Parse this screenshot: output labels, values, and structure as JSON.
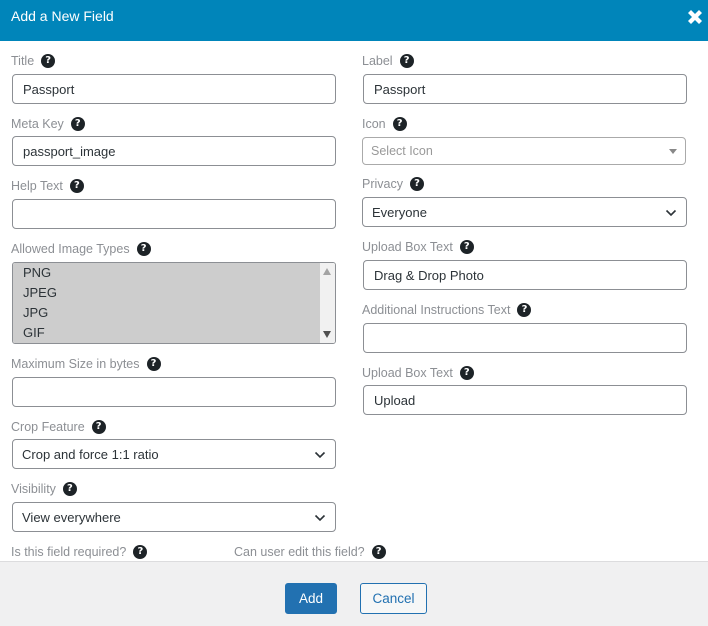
{
  "header": {
    "title": "Add a New Field",
    "close_icon": "close-x-icon"
  },
  "help_icon_glyph": "?",
  "left": {
    "title": {
      "label": "Title",
      "value": "Passport"
    },
    "meta_key": {
      "label": "Meta Key",
      "value": "passport_image"
    },
    "help_text": {
      "label": "Help Text",
      "value": ""
    },
    "allowed_image_types": {
      "label": "Allowed Image Types",
      "options": [
        "PNG",
        "JPEG",
        "JPG",
        "GIF"
      ]
    },
    "max_size": {
      "label": "Maximum Size in bytes",
      "value": ""
    },
    "crop_feature": {
      "label": "Crop Feature",
      "selected": "Crop and force 1:1 ratio"
    },
    "visibility": {
      "label": "Visibility",
      "selected": "View everywhere"
    },
    "required": {
      "label": "Is this field required?"
    },
    "user_edit": {
      "label": "Can user edit this field?"
    }
  },
  "right": {
    "label": {
      "label": "Label",
      "value": "Passport"
    },
    "icon": {
      "label": "Icon",
      "placeholder": "Select Icon"
    },
    "privacy": {
      "label": "Privacy",
      "selected": "Everyone"
    },
    "upload_box_text": {
      "label": "Upload Box Text",
      "value": "Drag & Drop Photo"
    },
    "additional_instructions": {
      "label": "Additional Instructions Text",
      "value": ""
    },
    "upload_box_text_2": {
      "label": "Upload Box Text",
      "value": "Upload"
    }
  },
  "footer": {
    "add_label": "Add",
    "cancel_label": "Cancel"
  },
  "colors": {
    "header": "#0085ba",
    "primary": "#2271b1",
    "footer_bg": "#f0f0f1"
  }
}
